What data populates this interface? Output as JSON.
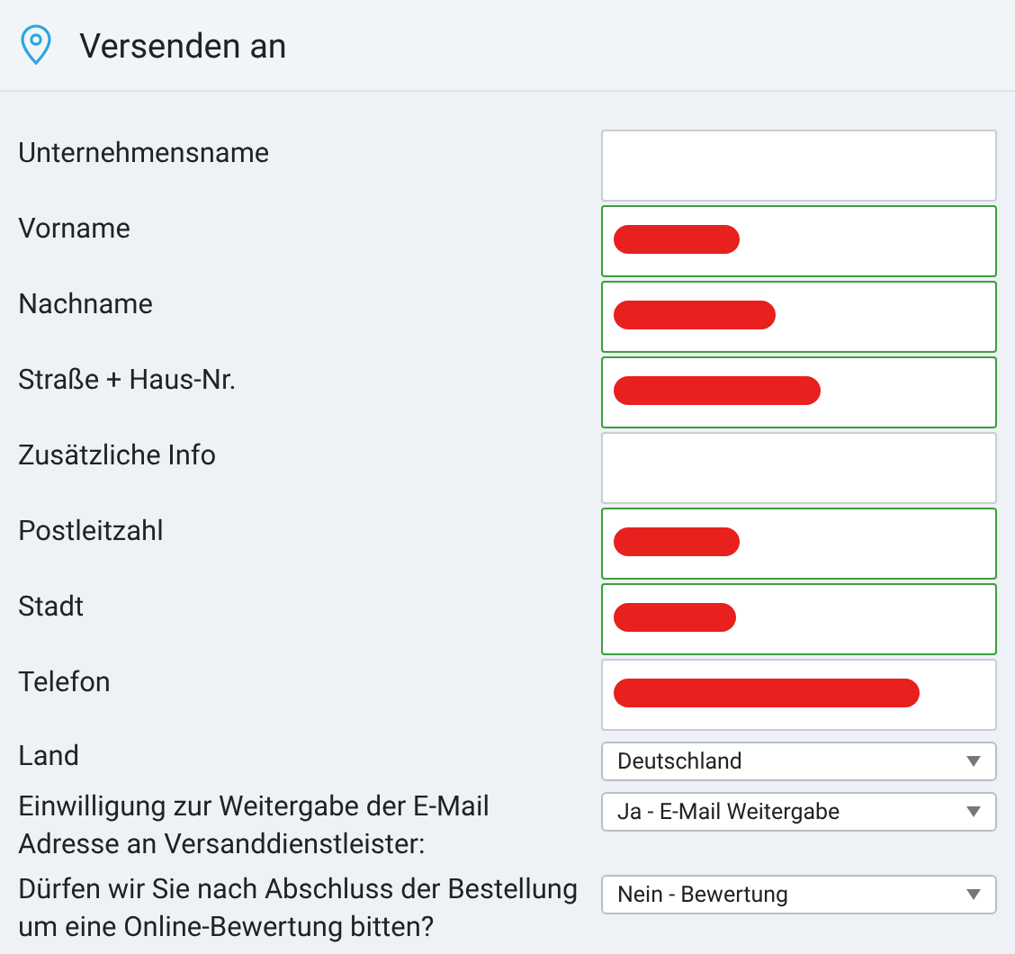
{
  "header": {
    "title": "Versenden an"
  },
  "fields": [
    {
      "label": "Unternehmensname",
      "valid": false,
      "redacted": false
    },
    {
      "label": "Vorname",
      "valid": true,
      "redacted": true
    },
    {
      "label": "Nachname",
      "valid": true,
      "redacted": true
    },
    {
      "label": "Straße + Haus-Nr.",
      "valid": true,
      "redacted": true
    },
    {
      "label": "Zusätzliche Info",
      "valid": false,
      "redacted": false
    },
    {
      "label": "Postleitzahl",
      "valid": true,
      "redacted": true
    },
    {
      "label": "Stadt",
      "valid": true,
      "redacted": true
    },
    {
      "label": "Telefon",
      "valid": false,
      "redacted": true
    }
  ],
  "selects": [
    {
      "label": "Land",
      "value": "Deutschland"
    },
    {
      "label": "Einwilligung zur Weitergabe der E-Mail Adresse an Versanddienstleister:",
      "value": "Ja - E-Mail Weitergabe"
    },
    {
      "label": "Dürfen wir Sie nach Abschluss der Bestellung um eine Online-Bewertung bitten?",
      "value": "Nein - Bewertung"
    }
  ]
}
